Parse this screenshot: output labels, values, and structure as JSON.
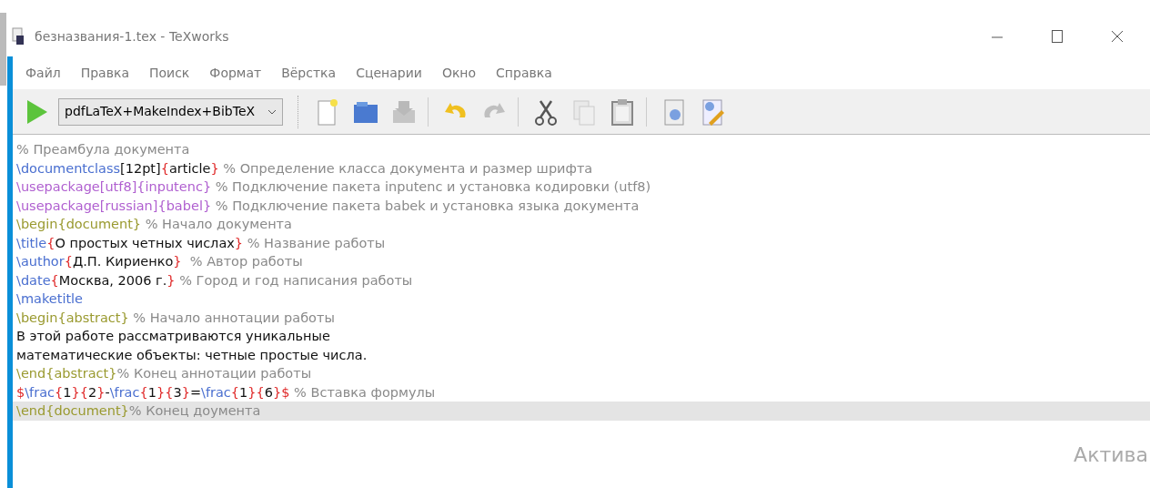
{
  "window": {
    "title": "безназвания-1.tex - TeXworks"
  },
  "menu": [
    "Файл",
    "Правка",
    "Поиск",
    "Формат",
    "Вёрстка",
    "Сценарии",
    "Окно",
    "Справка"
  ],
  "toolbar": {
    "engine": "pdfLaTeX+MakeIndex+BibTeX",
    "buttons": [
      {
        "kind": "new",
        "disabled": false
      },
      {
        "kind": "open",
        "disabled": false
      },
      {
        "kind": "save",
        "disabled": true
      },
      {
        "kind": "undo",
        "disabled": false
      },
      {
        "kind": "redo",
        "disabled": true
      },
      {
        "kind": "cut",
        "disabled": false
      },
      {
        "kind": "copy",
        "disabled": true
      },
      {
        "kind": "paste",
        "disabled": false
      },
      {
        "kind": "preview",
        "disabled": false
      },
      {
        "kind": "edit",
        "disabled": false
      }
    ]
  },
  "editor": {
    "lines": [
      {
        "current": false,
        "tokens": [
          {
            "kind": "comment",
            "text": "% Преамбула документа"
          }
        ]
      },
      {
        "current": false,
        "tokens": [
          {
            "kind": "cmd",
            "text": "\\documentclass"
          },
          {
            "kind": "text",
            "text": "[12pt]"
          },
          {
            "kind": "brace",
            "text": "{"
          },
          {
            "kind": "text",
            "text": "article"
          },
          {
            "kind": "brace",
            "text": "}"
          },
          {
            "kind": "comment",
            "text": " % Определение класса документа и размер шрифта"
          }
        ]
      },
      {
        "current": false,
        "tokens": [
          {
            "kind": "pkg",
            "text": "\\usepackage[utf8]{inputenc}"
          },
          {
            "kind": "comment",
            "text": " % Подключение пакета inputenc и установка кодировки (utf8)"
          }
        ]
      },
      {
        "current": false,
        "tokens": [
          {
            "kind": "pkg",
            "text": "\\usepackage[russian]{babel}"
          },
          {
            "kind": "comment",
            "text": " % Подключение пакета babek и установка языка документа"
          }
        ]
      },
      {
        "current": false,
        "tokens": [
          {
            "kind": "env",
            "text": "\\begin{document}"
          },
          {
            "kind": "comment",
            "text": " % Начало документа"
          }
        ]
      },
      {
        "current": false,
        "tokens": [
          {
            "kind": "cmd",
            "text": "\\title"
          },
          {
            "kind": "brace",
            "text": "{"
          },
          {
            "kind": "text",
            "text": "О простых четных числах"
          },
          {
            "kind": "brace",
            "text": "}"
          },
          {
            "kind": "comment",
            "text": " % Название работы"
          }
        ]
      },
      {
        "current": false,
        "tokens": [
          {
            "kind": "cmd",
            "text": "\\author"
          },
          {
            "kind": "brace",
            "text": "{"
          },
          {
            "kind": "text",
            "text": "Д.П. Кириенко"
          },
          {
            "kind": "brace",
            "text": "}"
          },
          {
            "kind": "comment",
            "text": "  % Автор работы"
          }
        ]
      },
      {
        "current": false,
        "tokens": [
          {
            "kind": "cmd",
            "text": "\\date"
          },
          {
            "kind": "brace",
            "text": "{"
          },
          {
            "kind": "text",
            "text": "Москва, 2006 г."
          },
          {
            "kind": "brace",
            "text": "}"
          },
          {
            "kind": "comment",
            "text": " % Город и год написания работы"
          }
        ]
      },
      {
        "current": false,
        "tokens": [
          {
            "kind": "cmd",
            "text": "\\maketitle"
          }
        ]
      },
      {
        "current": false,
        "tokens": [
          {
            "kind": "env",
            "text": "\\begin{abstract}"
          },
          {
            "kind": "comment",
            "text": " % Начало аннотации работы"
          }
        ]
      },
      {
        "current": false,
        "tokens": [
          {
            "kind": "text",
            "text": "В этой работе рассматриваются уникальные"
          }
        ]
      },
      {
        "current": false,
        "tokens": [
          {
            "kind": "text",
            "text": "математические объекты: четные простые числа."
          }
        ]
      },
      {
        "current": false,
        "tokens": [
          {
            "kind": "env",
            "text": "\\end{abstract}"
          },
          {
            "kind": "comment",
            "text": "% Конец аннотации работы"
          }
        ]
      },
      {
        "current": false,
        "tokens": [
          {
            "kind": "math",
            "text": "$"
          },
          {
            "kind": "cmd",
            "text": "\\frac"
          },
          {
            "kind": "brace",
            "text": "{"
          },
          {
            "kind": "text",
            "text": "1"
          },
          {
            "kind": "brace",
            "text": "}{"
          },
          {
            "kind": "text",
            "text": "2"
          },
          {
            "kind": "brace",
            "text": "}"
          },
          {
            "kind": "text",
            "text": "-"
          },
          {
            "kind": "cmd",
            "text": "\\frac"
          },
          {
            "kind": "brace",
            "text": "{"
          },
          {
            "kind": "text",
            "text": "1"
          },
          {
            "kind": "brace",
            "text": "}{"
          },
          {
            "kind": "text",
            "text": "3"
          },
          {
            "kind": "brace",
            "text": "}"
          },
          {
            "kind": "text",
            "text": "="
          },
          {
            "kind": "cmd",
            "text": "\\frac"
          },
          {
            "kind": "brace",
            "text": "{"
          },
          {
            "kind": "text",
            "text": "1"
          },
          {
            "kind": "brace",
            "text": "}{"
          },
          {
            "kind": "text",
            "text": "6"
          },
          {
            "kind": "brace",
            "text": "}"
          },
          {
            "kind": "math",
            "text": "$"
          },
          {
            "kind": "comment",
            "text": " % Вставка формулы"
          }
        ]
      },
      {
        "current": true,
        "tokens": [
          {
            "kind": "env",
            "text": "\\end{document}"
          },
          {
            "kind": "comment",
            "text": "% Конец доумента"
          }
        ]
      }
    ]
  },
  "overlay_text": "Актива"
}
